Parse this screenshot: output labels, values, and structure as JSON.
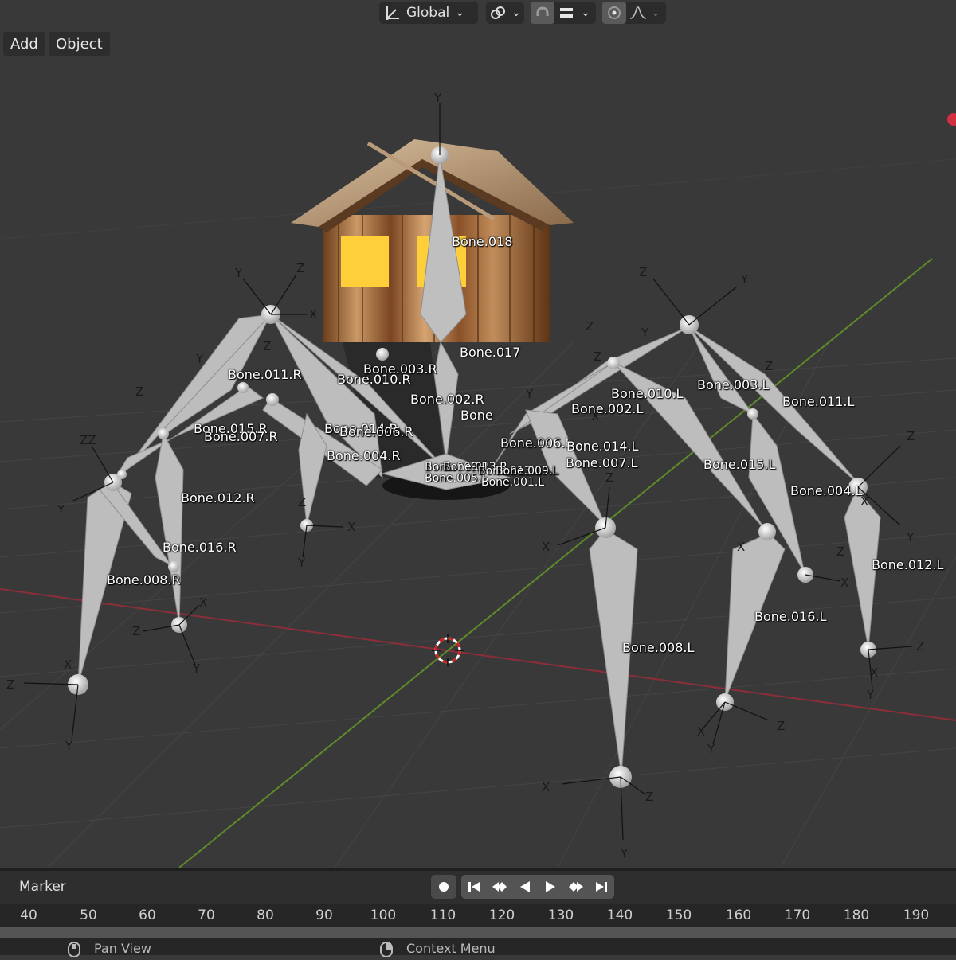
{
  "header": {
    "transform_orientation": "Global",
    "pivot_icon": "transform-axes-icon",
    "chevron": "⌄"
  },
  "menu": {
    "add_label": "Add",
    "object_label": "Object"
  },
  "bones": [
    {
      "id": "b018",
      "label": "Bone.018"
    },
    {
      "id": "b017",
      "label": "Bone.017"
    },
    {
      "id": "b003r",
      "label": "Bone.003.R"
    },
    {
      "id": "b010r",
      "label": "Bone.010.R"
    },
    {
      "id": "b011r",
      "label": "Bone.011.R"
    },
    {
      "id": "b002r",
      "label": "Bone.002.R"
    },
    {
      "id": "bone",
      "label": "Bone"
    },
    {
      "id": "b015r",
      "label": "Bone.015.R"
    },
    {
      "id": "b007r",
      "label": "Bone.007.R"
    },
    {
      "id": "b014r",
      "label": "Bone.014.R"
    },
    {
      "id": "b006r",
      "label": "Bone.006.R"
    },
    {
      "id": "b004r",
      "label": "Bone.004.R"
    },
    {
      "id": "b012r",
      "label": "Bone.012.R"
    },
    {
      "id": "b016r",
      "label": "Bone.016.R"
    },
    {
      "id": "b008r",
      "label": "Bone.008.R"
    },
    {
      "id": "b010l",
      "label": "Bone.010.L"
    },
    {
      "id": "b003l",
      "label": "Bone.003.L"
    },
    {
      "id": "b011l",
      "label": "Bone.011.L"
    },
    {
      "id": "b002l",
      "label": "Bone.002.L"
    },
    {
      "id": "b006l",
      "label": "Bone.006.L"
    },
    {
      "id": "b014l",
      "label": "Bone.014.L"
    },
    {
      "id": "b007l",
      "label": "Bone.007.L"
    },
    {
      "id": "b015l",
      "label": "Bone.015.L"
    },
    {
      "id": "b004l",
      "label": "Bone.004.L"
    },
    {
      "id": "b012l",
      "label": "Bone.012.L"
    },
    {
      "id": "b016l",
      "label": "Bone.016.L"
    },
    {
      "id": "b008l",
      "label": "Bone.008.L"
    },
    {
      "id": "b009r",
      "label": "Bone.009.R"
    },
    {
      "id": "b013r",
      "label": "Bone.013.R"
    },
    {
      "id": "b005l",
      "label": "Bone.005.L"
    },
    {
      "id": "b013l",
      "label": "Bone.013.L"
    },
    {
      "id": "b001l",
      "label": "Bone.001.L"
    },
    {
      "id": "b009l",
      "label": "Bone.009.L"
    }
  ],
  "timeline": {
    "marker_label": "Marker",
    "frames": [
      "40",
      "50",
      "60",
      "70",
      "80",
      "90",
      "100",
      "110",
      "120",
      "130",
      "140",
      "150",
      "160",
      "170",
      "180",
      "190"
    ]
  },
  "status": {
    "pan_view": "Pan View",
    "context_menu": "Context Menu"
  },
  "colors": {
    "viewport_bg": "#393939",
    "grid": "#4a4a4a",
    "x_axis": "#8c2e3a",
    "y_axis": "#5f8a2a",
    "bone": "#bdbdbd",
    "timeline_bg": "#2e2e2e"
  }
}
